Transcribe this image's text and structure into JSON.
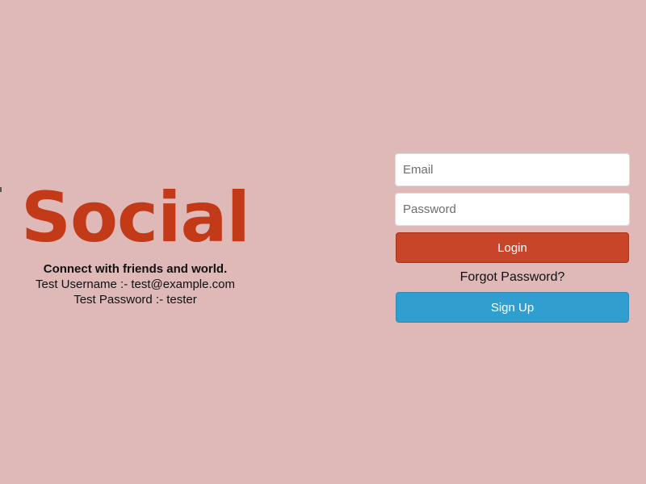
{
  "colors": {
    "background": "#dfb9b8",
    "brand": "#c23a18",
    "login_button": "#c9452a",
    "signup_button": "#309ece"
  },
  "brand": {
    "logo_text": "Social",
    "tagline": "Connect with friends and world.",
    "test_username": "Test Username :- test@example.com",
    "test_password": "Test Password :- tester"
  },
  "login_form": {
    "email": {
      "value": "",
      "placeholder": "Email"
    },
    "password": {
      "value": "",
      "placeholder": "Password"
    },
    "login_label": "Login",
    "forgot_label": "Forgot Password?",
    "signup_label": "Sign Up"
  }
}
